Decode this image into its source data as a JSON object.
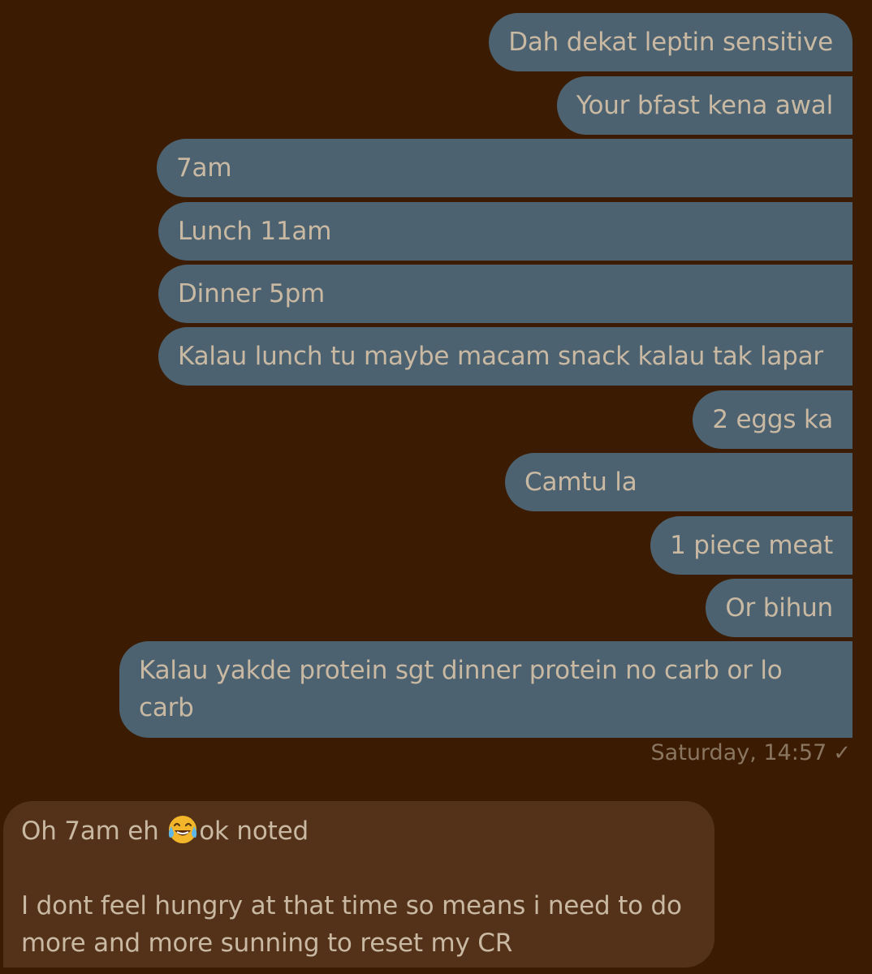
{
  "outgoing_messages": [
    {
      "text": "Dah dekat leptin sensitive"
    },
    {
      "text": "Your bfast kena awal"
    },
    {
      "text": "7am"
    },
    {
      "text": "Lunch 11am"
    },
    {
      "text": "Dinner 5pm"
    },
    {
      "text": "Kalau lunch tu maybe macam snack kalau tak lapar"
    },
    {
      "text": "2 eggs ka"
    },
    {
      "text": "Camtu la"
    },
    {
      "text": "1 piece meat"
    },
    {
      "text": "Or bihun"
    },
    {
      "text": "Kalau yakde protein sgt dinner protein no carb or lo carb"
    }
  ],
  "outgoing_timestamp": "Saturday, 14:57",
  "read_check": "✓",
  "incoming_message": {
    "line1_before_emoji": "Oh 7am eh ",
    "emoji_name": "face-with-tears-of-joy",
    "line1_after_emoji": "ok noted",
    "paragraph2": "I dont feel hungry at that time so means i need to do more and more sunning to reset my CR"
  },
  "colors": {
    "background": "#3b1c02",
    "outgoing_bubble": "#4c6270",
    "incoming_bubble": "#54321a",
    "text": "#c9b9a3",
    "timestamp": "#8a7560"
  }
}
